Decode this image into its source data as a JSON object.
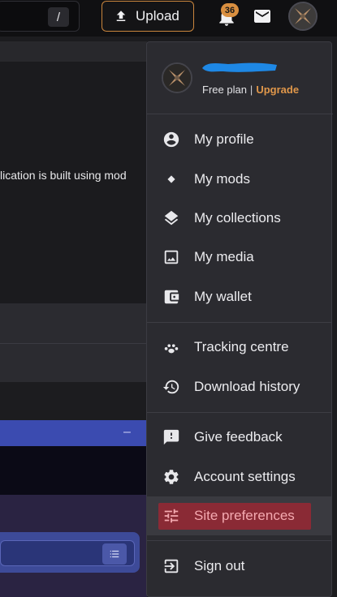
{
  "header": {
    "search_shortcut": "/",
    "upload_label": "Upload",
    "notification_count": "36"
  },
  "background": {
    "text_fragment": "lication is built using mod"
  },
  "menu": {
    "plan_label": "Free plan",
    "upgrade_label": "Upgrade",
    "groups": [
      [
        "My profile",
        "My mods",
        "My collections",
        "My media",
        "My wallet"
      ],
      [
        "Tracking centre",
        "Download history"
      ],
      [
        "Give feedback",
        "Account settings",
        "Site preferences"
      ],
      [
        "Sign out"
      ]
    ],
    "items": {
      "my_profile": "My profile",
      "my_mods": "My mods",
      "my_collections": "My collections",
      "my_media": "My media",
      "my_wallet": "My wallet",
      "tracking_centre": "Tracking centre",
      "download_history": "Download history",
      "give_feedback": "Give feedback",
      "account_settings": "Account settings",
      "site_preferences": "Site preferences",
      "sign_out": "Sign out"
    },
    "highlighted": "Site preferences"
  },
  "colors": {
    "accent": "#d98f40",
    "highlight": "#8a2a35",
    "menu_bg": "#2b2b30",
    "username_redaction": "#1e88e5"
  },
  "icons": [
    "upload-icon",
    "bell-icon",
    "mail-icon",
    "user-circle-icon",
    "diamond-icon",
    "layers-icon",
    "image-icon",
    "wallet-icon",
    "paw-icon",
    "history-icon",
    "feedback-icon",
    "gear-icon",
    "sliders-icon",
    "logout-icon",
    "list-icon"
  ]
}
